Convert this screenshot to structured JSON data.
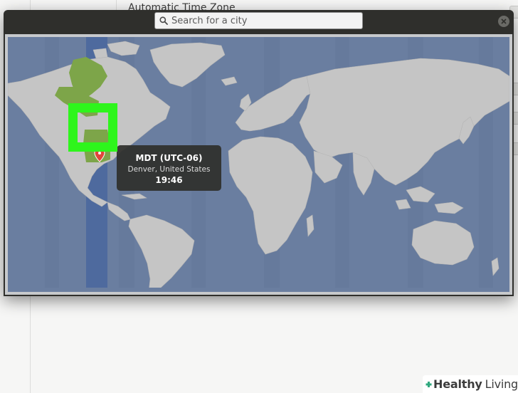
{
  "background_window": {
    "automatic_time_zone_label": "Automatic Time Zone"
  },
  "dialog": {
    "search": {
      "placeholder": "Search for a city",
      "value": ""
    },
    "close_icon": "close-icon",
    "map": {
      "selected_timezone_highlight_color": "#7da549",
      "ocean_color": "#6a7ea0",
      "land_color": "#c5c5c5"
    },
    "tooltip": {
      "timezone": "MDT (UTC-06)",
      "location": "Denver, United States",
      "time": "19:46"
    }
  },
  "annotation": {
    "highlight_color": "#2ef51c"
  },
  "watermark": {
    "brand_bold": "Healthy",
    "brand_light": "Living",
    "icon": "plus-cross-icon"
  }
}
